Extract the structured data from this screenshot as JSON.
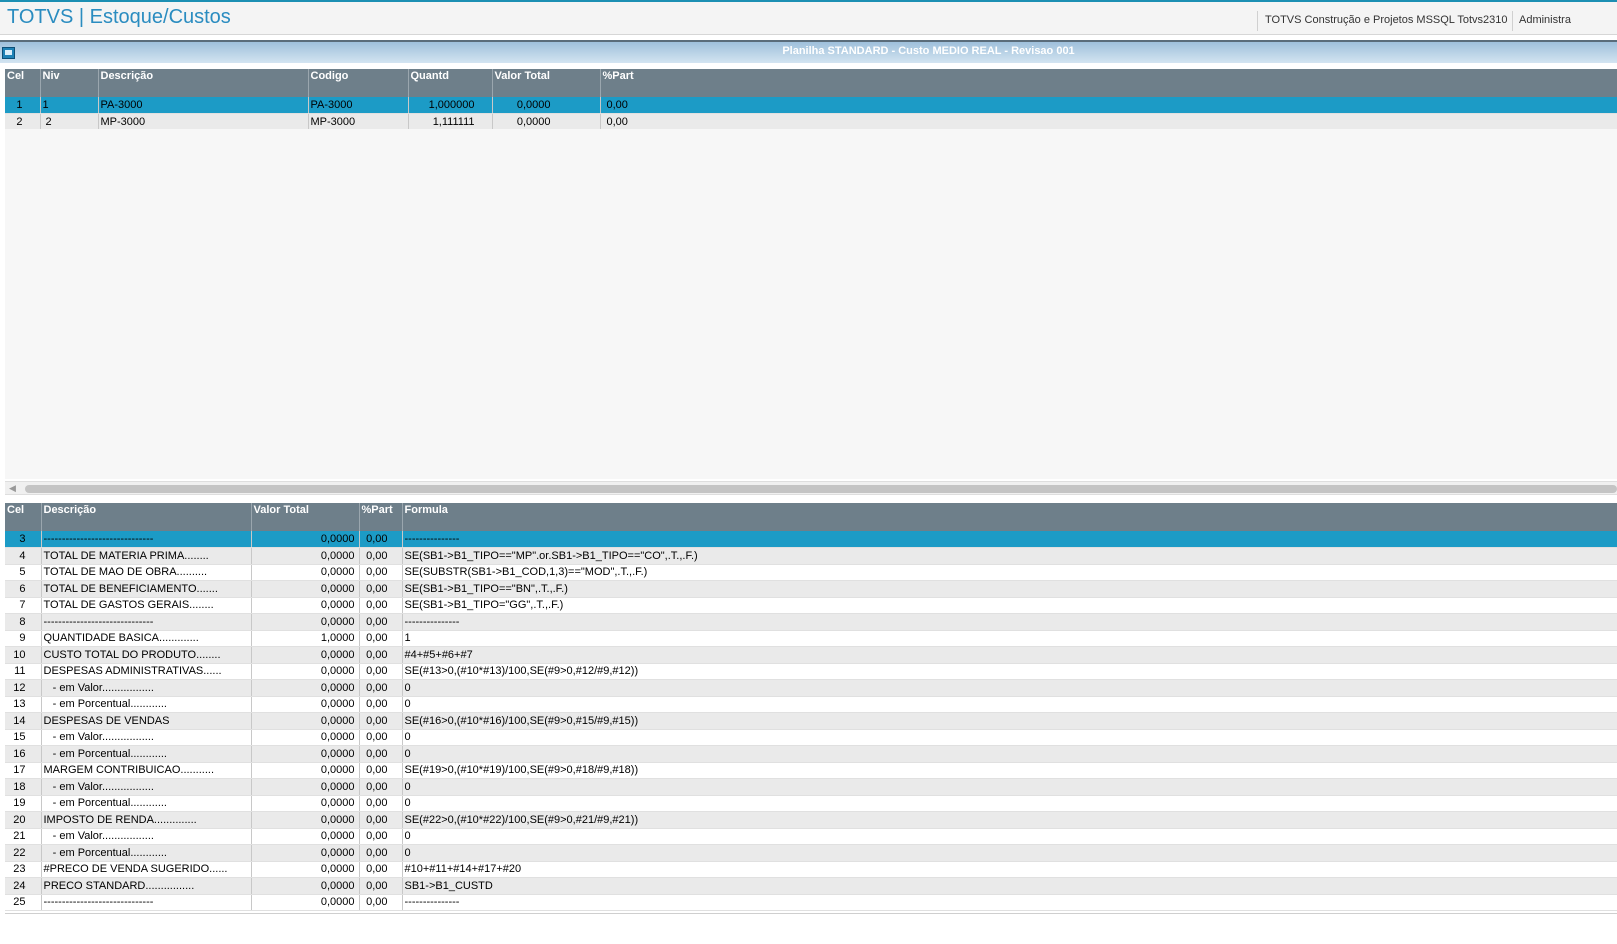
{
  "header": {
    "app_title": "TOTVS | Estoque/Custos",
    "environment": "TOTVS Construção e Projetos MSSQL Totvs2310",
    "user": "Administra"
  },
  "window": {
    "title": "Planilha STANDARD - Custo MEDIO REAL - Revisao 001"
  },
  "structure_grid": {
    "columns": [
      "Cel",
      "Niv",
      "Descrição",
      "Codigo",
      "Quantd",
      "Valor Total",
      "%Part"
    ],
    "rows": [
      {
        "cel": "1",
        "niv": "1",
        "descricao": "PA-3000",
        "codigo": "PA-3000",
        "quantd": "1,000000",
        "valor_total": "0,0000",
        "part": "0,00"
      },
      {
        "cel": "2",
        "niv": "2",
        "descricao": "MP-3000",
        "codigo": "MP-3000",
        "quantd": "1,111111",
        "valor_total": "0,0000",
        "part": "0,00"
      }
    ]
  },
  "formula_grid": {
    "columns": [
      "Cel",
      "Descrição",
      "Valor Total",
      "%Part",
      "Formula"
    ],
    "rows": [
      {
        "cel": "3",
        "descricao": "------------------------------",
        "valor_total": "0,0000",
        "part": "0,00",
        "formula": "---------------"
      },
      {
        "cel": "4",
        "descricao": "TOTAL DE MATERIA PRIMA........",
        "valor_total": "0,0000",
        "part": "0,00",
        "formula": "SE(SB1->B1_TIPO==\"MP\".or.SB1->B1_TIPO==\"CO\",.T.,.F.)"
      },
      {
        "cel": "5",
        "descricao": "TOTAL DE MAO DE OBRA..........",
        "valor_total": "0,0000",
        "part": "0,00",
        "formula": "SE(SUBSTR(SB1->B1_COD,1,3)==\"MOD\",.T.,.F.)"
      },
      {
        "cel": "6",
        "descricao": "TOTAL DE BENEFICIAMENTO.......",
        "valor_total": "0,0000",
        "part": "0,00",
        "formula": "SE(SB1->B1_TIPO==\"BN\",.T.,.F.)"
      },
      {
        "cel": "7",
        "descricao": "TOTAL DE GASTOS GERAIS........",
        "valor_total": "0,0000",
        "part": "0,00",
        "formula": "SE(SB1->B1_TIPO=\"GG\",.T.,.F.)"
      },
      {
        "cel": "8",
        "descricao": "------------------------------",
        "valor_total": "0,0000",
        "part": "0,00",
        "formula": "---------------"
      },
      {
        "cel": "9",
        "descricao": "QUANTIDADE BASICA.............",
        "valor_total": "1,0000",
        "part": "0,00",
        "formula": "1"
      },
      {
        "cel": "10",
        "descricao": "CUSTO TOTAL DO PRODUTO........",
        "valor_total": "0,0000",
        "part": "0,00",
        "formula": "#4+#5+#6+#7"
      },
      {
        "cel": "11",
        "descricao": "DESPESAS ADMINISTRATIVAS......",
        "valor_total": "0,0000",
        "part": "0,00",
        "formula": "SE(#13>0,(#10*#13)/100,SE(#9>0,#12/#9,#12))"
      },
      {
        "cel": "12",
        "descricao": "   - em Valor.................",
        "valor_total": "0,0000",
        "part": "0,00",
        "formula": "0"
      },
      {
        "cel": "13",
        "descricao": "   - em Porcentual............",
        "valor_total": "0,0000",
        "part": "0,00",
        "formula": "0"
      },
      {
        "cel": "14",
        "descricao": "DESPESAS DE VENDAS",
        "valor_total": "0,0000",
        "part": "0,00",
        "formula": "SE(#16>0,(#10*#16)/100,SE(#9>0,#15/#9,#15))"
      },
      {
        "cel": "15",
        "descricao": "   - em Valor.................",
        "valor_total": "0,0000",
        "part": "0,00",
        "formula": "0"
      },
      {
        "cel": "16",
        "descricao": "   - em Porcentual............",
        "valor_total": "0,0000",
        "part": "0,00",
        "formula": "0"
      },
      {
        "cel": "17",
        "descricao": "MARGEM CONTRIBUICAO...........",
        "valor_total": "0,0000",
        "part": "0,00",
        "formula": "SE(#19>0,(#10*#19)/100,SE(#9>0,#18/#9,#18))"
      },
      {
        "cel": "18",
        "descricao": "   - em Valor.................",
        "valor_total": "0,0000",
        "part": "0,00",
        "formula": "0"
      },
      {
        "cel": "19",
        "descricao": "   - em Porcentual............",
        "valor_total": "0,0000",
        "part": "0,00",
        "formula": "0"
      },
      {
        "cel": "20",
        "descricao": "IMPOSTO DE RENDA..............",
        "valor_total": "0,0000",
        "part": "0,00",
        "formula": "SE(#22>0,(#10*#22)/100,SE(#9>0,#21/#9,#21))"
      },
      {
        "cel": "21",
        "descricao": "   - em Valor.................",
        "valor_total": "0,0000",
        "part": "0,00",
        "formula": "0"
      },
      {
        "cel": "22",
        "descricao": "   - em Porcentual............",
        "valor_total": "0,0000",
        "part": "0,00",
        "formula": "0"
      },
      {
        "cel": "23",
        "descricao": "#PRECO DE VENDA SUGERIDO......",
        "valor_total": "0,0000",
        "part": "0,00",
        "formula": "#10+#11+#14+#17+#20"
      },
      {
        "cel": "24",
        "descricao": "PRECO STANDARD................",
        "valor_total": "0,0000",
        "part": "0,00",
        "formula": "SB1->B1_CUSTD"
      },
      {
        "cel": "25",
        "descricao": "------------------------------",
        "valor_total": "0,0000",
        "part": "0,00",
        "formula": "---------------"
      }
    ]
  },
  "colors": {
    "selected_row": "#1c9bc6",
    "header_bg": "#6e7f8a",
    "title_blue": "#2a8cc0"
  }
}
